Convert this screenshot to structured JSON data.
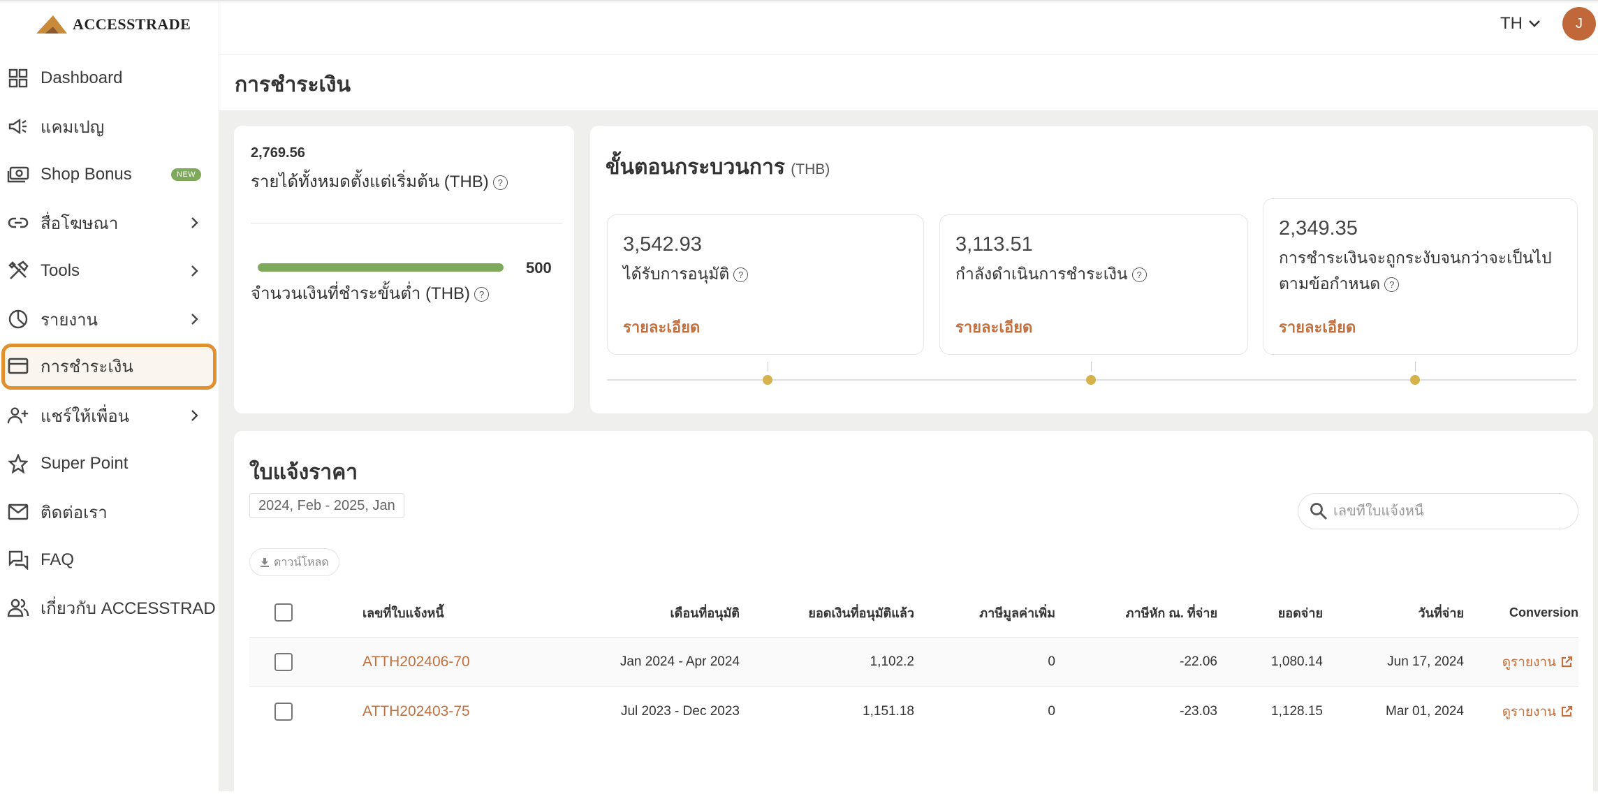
{
  "brand": {
    "logo_text": "ACCESSTRADE",
    "accent": "#c2703f",
    "active_outline": "#e0902f",
    "progress_color": "#7fa95a"
  },
  "header": {
    "language": "TH",
    "avatar_initial": "J"
  },
  "sidebar": {
    "items": [
      {
        "label": "Dashboard",
        "icon": "dashboard-grid-icon"
      },
      {
        "label": "แคมเปญ",
        "icon": "megaphone-icon"
      },
      {
        "label": "Shop Bonus",
        "icon": "money-icon",
        "badge": "NEW"
      },
      {
        "label": "สื่อโฆษณา",
        "icon": "link-icon",
        "has_submenu": true
      },
      {
        "label": "Tools",
        "icon": "tools-icon",
        "has_submenu": true
      },
      {
        "label": "รายงาน",
        "icon": "pie-chart-icon",
        "has_submenu": true
      },
      {
        "label": "การชำระเงิน",
        "icon": "credit-card-icon",
        "active": true
      },
      {
        "label": "แชร์ให้เพื่อน",
        "icon": "add-user-icon",
        "has_submenu": true
      },
      {
        "label": "Super Point",
        "icon": "star-icon"
      },
      {
        "label": "ติดต่อเรา",
        "icon": "mail-icon"
      },
      {
        "label": "FAQ",
        "icon": "chat-icon"
      },
      {
        "label": "เกี่ยวกับ ACCESSTRAD",
        "icon": "users-icon"
      }
    ]
  },
  "page": {
    "title": "การชำระเงิน"
  },
  "summary": {
    "total_value": "2,769.56",
    "total_label": "รายได้ทั้งหมดตั้งแต่เริ่มต้น (THB)",
    "min_payment_max": "500",
    "min_payment_label": "จำนวนเงินที่ชำระขั้นต่ำ (THB)",
    "progress_fraction": 1.0
  },
  "process": {
    "title": "ขั้นตอนกระบวนการ",
    "unit": "(THB)",
    "steps": [
      {
        "amount": "3,542.93",
        "label": "ได้รับการอนุมัติ",
        "link": "รายละเอียด"
      },
      {
        "amount": "3,113.51",
        "label": "กำลังดำเนินการชำระเงิน",
        "link": "รายละเอียด"
      },
      {
        "amount": "2,349.35",
        "label_line1": "การชำระเงินจะถูกระงับจนกว่าจะเป็นไป",
        "label_line2": "ตามข้อกำหนด",
        "link": "รายละเอียด"
      }
    ]
  },
  "invoices": {
    "title": "ใบแจ้งราคา",
    "date_range": "2024, Feb - 2025, Jan",
    "download_label": "ดาวน์โหลด",
    "search_placeholder": "เลขที่ใบแจ้งหนี้",
    "columns": [
      "เลขที่ใบแจ้งหนี้",
      "เดือนที่อนุมัติ",
      "ยอดเงินที่อนุมัติแล้ว",
      "ภาษีมูลค่าเพิ่ม",
      "ภาษีหัก ณ. ที่จ่าย",
      "ยอดจ่าย",
      "วันที่จ่าย",
      "Conversion"
    ],
    "rows": [
      {
        "invoice": "ATTH202406-70",
        "month": "Jan 2024 - Apr 2024",
        "approved": "1,102.2",
        "vat": "0",
        "wht": "-22.06",
        "paid": "1,080.14",
        "date": "Jun 17, 2024",
        "conversion": "ดูรายงาน"
      },
      {
        "invoice": "ATTH202403-75",
        "month": "Jul 2023 - Dec 2023",
        "approved": "1,151.18",
        "vat": "0",
        "wht": "-23.03",
        "paid": "1,128.15",
        "date": "Mar 01, 2024",
        "conversion": "ดูรายงาน"
      }
    ]
  }
}
